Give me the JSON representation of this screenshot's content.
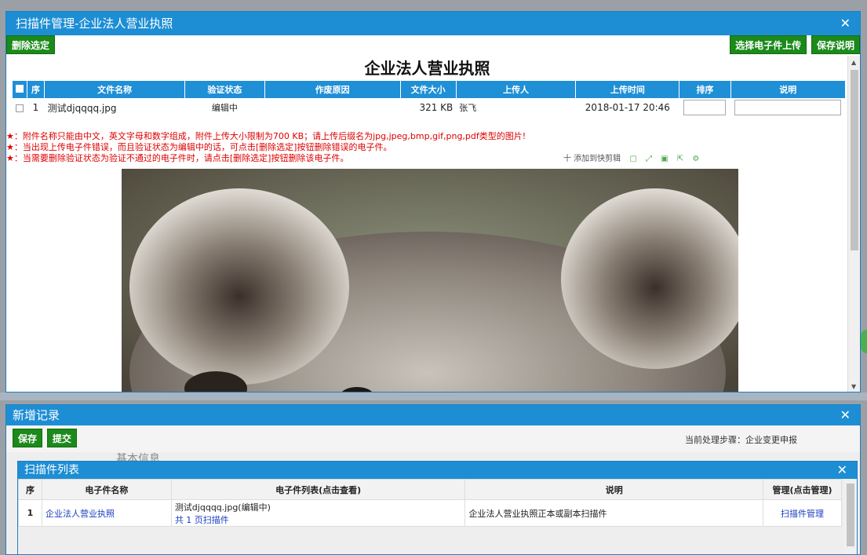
{
  "dialog_scan": {
    "title": "扫描件管理-企业法人营业执照",
    "delete_selected": "删除选定",
    "select_upload": "选择电子件上传",
    "save_description": "保存说明",
    "doc_title": "企业法人营业执照",
    "columns": [
      "序",
      "文件名称",
      "验证状态",
      "作废原因",
      "文件大小",
      "上传人",
      "上传时间",
      "排序",
      "说明"
    ],
    "rows": [
      {
        "seq": "1",
        "filename": "测试djqqqq.jpg",
        "status": "编辑中",
        "reason": "",
        "size": "321 KB",
        "uploader": "张飞",
        "time": "2018-01-17 20:46"
      }
    ],
    "notes": [
      "★：附件名称只能由中文，英文字母和数字组成，附件上传大小限制为700 KB；请上传后缀名为jpg,jpeg,bmp,gif,png,pdf类型的图片!",
      "★：当出现上传电子件错误，而且验证状态为编辑中的话，可点击[删除选定]按钮删除错误的电子件。",
      "★：当需要删除验证状态为验证不通过的电子件时，请点击[删除选定]按钮删除该电子件。"
    ],
    "viewer_add": "十 添加到快剪辑"
  },
  "dialog_new": {
    "title": "新增记录",
    "save": "保存",
    "submit": "提交",
    "step_label": "当前处理步骤：企业变更申报",
    "behind_text": "基本信息"
  },
  "dialog_list": {
    "title": "扫描件列表",
    "columns": [
      "序",
      "电子件名称",
      "电子件列表(点击查看)",
      "说明",
      "管理(点击管理)"
    ],
    "rows": [
      {
        "seq": "1",
        "name": "企业法人营业执照",
        "file": "测试djqqqq.jpg(编辑中)",
        "pages": "共 1 页扫描件",
        "desc": "企业法人营业执照正本或副本扫描件",
        "manage": "扫描件管理"
      }
    ]
  },
  "colors": {
    "titlebar": "#1e8ed4",
    "button": "#1b8a1b",
    "notes": "#dd0000",
    "link": "#1a3ec2"
  }
}
